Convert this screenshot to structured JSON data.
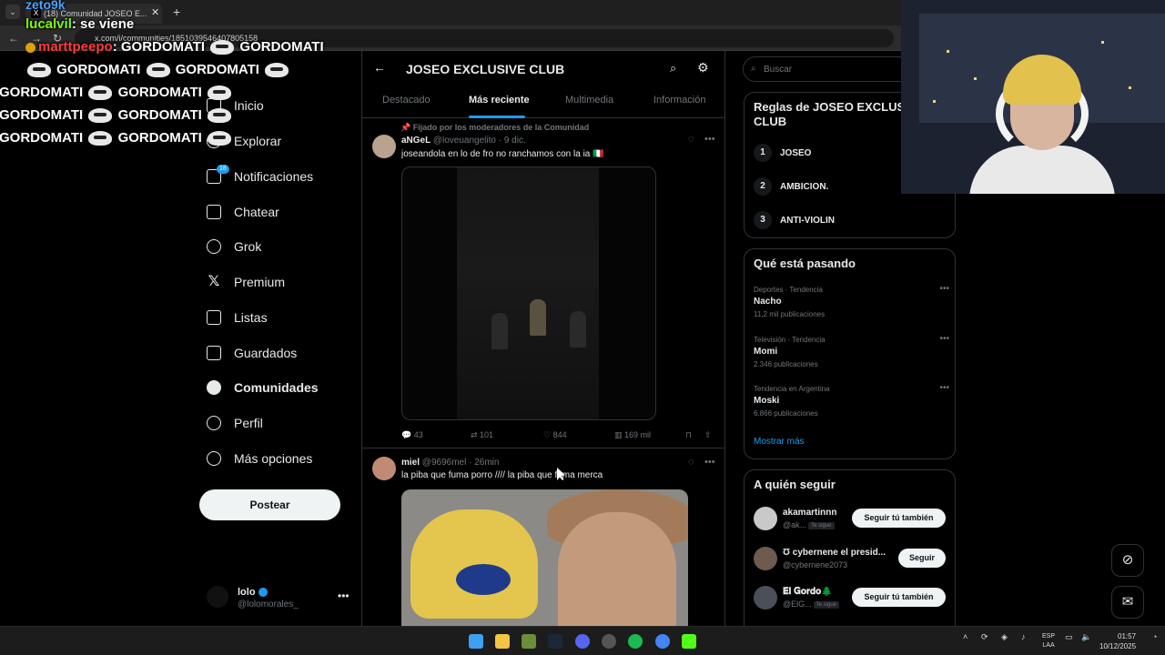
{
  "browser": {
    "tab_title": "(18) Comunidad JOSEO E...",
    "url": "x.com/i/communities/1851039546407805158"
  },
  "stream_chat": {
    "top_user": "zeto9k",
    "lines": [
      {
        "user": "lucalvil",
        "message": "se viene"
      },
      {
        "user": "marttpeepo",
        "message": "GORDOMATI"
      }
    ],
    "spam_word": "GORDOMATI"
  },
  "nav": {
    "items": [
      {
        "label": "Inicio",
        "icon": "home-icon"
      },
      {
        "label": "Explorar",
        "icon": "search-icon"
      },
      {
        "label": "Notificaciones",
        "icon": "bell-icon",
        "badge": "18"
      },
      {
        "label": "Chatear",
        "icon": "mail-icon"
      },
      {
        "label": "Grok",
        "icon": "grok-icon"
      },
      {
        "label": "Premium",
        "icon": "x-icon"
      },
      {
        "label": "Listas",
        "icon": "list-icon"
      },
      {
        "label": "Guardados",
        "icon": "bookmark-icon"
      },
      {
        "label": "Comunidades",
        "icon": "communities-icon"
      },
      {
        "label": "Perfil",
        "icon": "person-icon"
      },
      {
        "label": "Más opciones",
        "icon": "more-icon"
      }
    ],
    "post_button": "Postear",
    "profile": {
      "name": "lolo",
      "handle": "@lolomorales_"
    }
  },
  "community": {
    "title": "JOSEO EXCLUSIVE CLUB",
    "tabs": [
      "Destacado",
      "Más reciente",
      "Multimedia",
      "Información"
    ],
    "active_tab": "Más reciente"
  },
  "posts": [
    {
      "pinned_label": "Fijado por los moderadores de la Comunidad",
      "name": "aNGeL",
      "handle": "@loveuangelito",
      "time": "9 dic.",
      "text": "joseandola en lo de fro no ranchamos con la ia 🇮🇹",
      "replies": "43",
      "reposts": "101",
      "likes": "844",
      "views": "169 mil"
    },
    {
      "name": "miel",
      "handle": "@9696mel",
      "time": "26min",
      "text": "la piba que fuma porro //// la piba que fuma merca"
    }
  ],
  "right": {
    "search_placeholder": "Buscar",
    "rules_title": "Reglas de JOSEO EXCLUSIVE CLUB",
    "rules": [
      {
        "num": "1",
        "text": "JOSEO"
      },
      {
        "num": "2",
        "text": "AMBICION."
      },
      {
        "num": "3",
        "text": "ANTI-VIOLIN"
      }
    ],
    "trends_title": "Qué está pasando",
    "trends": [
      {
        "category": "Deportes · Tendencia",
        "name": "Nacho",
        "count": "11,2 mil publicaciones"
      },
      {
        "category": "Televisión · Tendencia",
        "name": "Momi",
        "count": "2.346 publicaciones"
      },
      {
        "category": "Tendencia en Argentina",
        "name": "Moski",
        "count": "6.866 publicaciones"
      }
    ],
    "show_more": "Mostrar más",
    "who_title": "A quién seguir",
    "who": [
      {
        "name": "akamartinnn",
        "handle": "@ak...",
        "follows_you": "Te sigue",
        "button": "Seguir tú también"
      },
      {
        "name": "Ʊ cybernene el presid...",
        "handle": "@cybernene2073",
        "follows_you": "",
        "button": "Seguir"
      },
      {
        "name": "𝐄𝐥 𝐆𝐨𝐫𝐝𝐨🌲",
        "handle": "@ElG...",
        "follows_you": "Te sigue",
        "button": "Seguir tú también"
      }
    ]
  },
  "taskbar": {
    "lang": "ESP",
    "layout": "LAA",
    "time": "01:57",
    "date": "10/12/2025"
  }
}
